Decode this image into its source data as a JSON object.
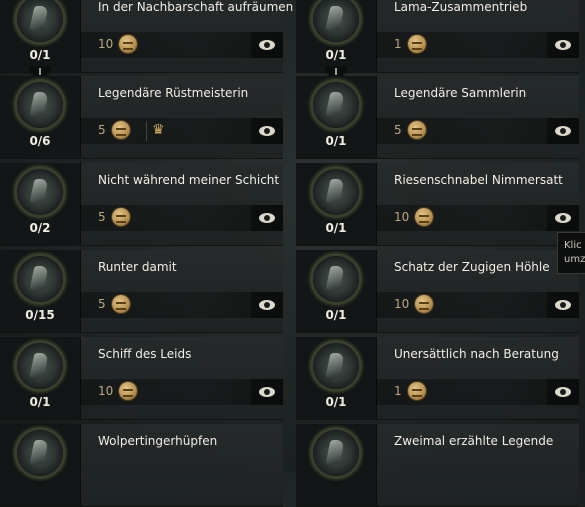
{
  "achievements": [
    {
      "title": "In der Nachbarschaft aufräumen",
      "progress": "0/1",
      "points": "10",
      "has_crown": false
    },
    {
      "title": "Lama-Zusammentrieb",
      "progress": "0/1",
      "points": "1",
      "has_crown": false
    },
    {
      "title": "Legendäre Rüstmeisterin",
      "progress": "0/6",
      "points": "5",
      "has_crown": true
    },
    {
      "title": "Legendäre Sammlerin",
      "progress": "0/1",
      "points": "5",
      "has_crown": false
    },
    {
      "title": "Nicht während meiner Schicht",
      "progress": "0/2",
      "points": "5",
      "has_crown": false
    },
    {
      "title": "Riesenschnabel Nimmersatt",
      "progress": "0/1",
      "points": "10",
      "has_crown": false
    },
    {
      "title": "Runter damit",
      "progress": "0/15",
      "points": "5",
      "has_crown": false
    },
    {
      "title": "Schatz der Zugigen Höhle",
      "progress": "0/1",
      "points": "10",
      "has_crown": false
    },
    {
      "title": "Schiff des Leids",
      "progress": "0/1",
      "points": "10",
      "has_crown": false
    },
    {
      "title": "Unersättlich nach Beratung",
      "progress": "0/1",
      "points": "1",
      "has_crown": false
    },
    {
      "title": "Wolpertingerhüpfen",
      "progress": "",
      "points": "",
      "has_crown": false
    },
    {
      "title": "Zweimal erzählte Legende",
      "progress": "",
      "points": "",
      "has_crown": false
    }
  ],
  "tooltip": {
    "line1": "Klic",
    "line2": "umz"
  },
  "icons": {
    "reward": "ap-coin-icon",
    "track": "eye-icon",
    "bonus": "crown-icon",
    "emblem": "achievement-emblem-icon"
  }
}
